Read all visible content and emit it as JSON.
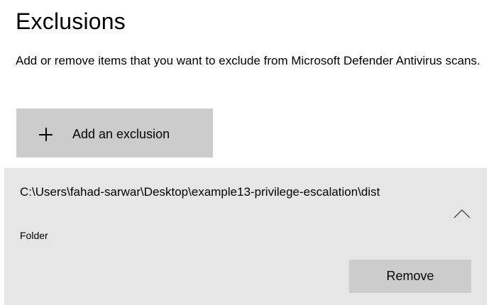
{
  "page": {
    "title": "Exclusions",
    "description": "Add or remove items that you want to exclude from Microsoft Defender Antivirus scans."
  },
  "add_button": {
    "icon": "plus-icon",
    "label": "Add an exclusion"
  },
  "exclusions": [
    {
      "path": "C:\\Users\\fahad-sarwar\\Desktop\\example13-privilege-escalation\\dist",
      "type": "Folder",
      "expanded": true,
      "expand_icon": "chevron-up-icon",
      "remove_label": "Remove"
    }
  ],
  "colors": {
    "button_bg": "#cccccc",
    "card_bg": "#e6e6e6",
    "text": "#000000",
    "background": "#ffffff"
  }
}
